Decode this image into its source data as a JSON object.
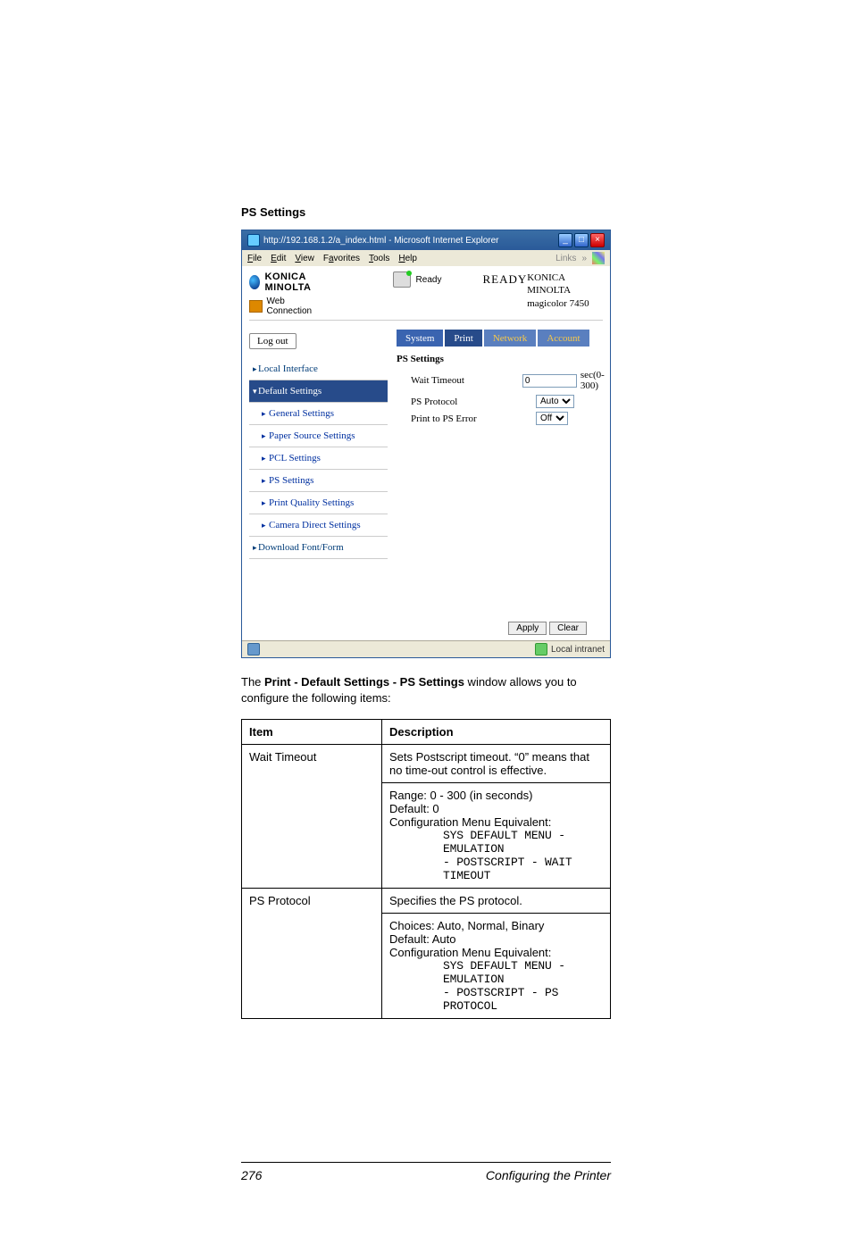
{
  "section_title": "PS Settings",
  "browser": {
    "title": "http://192.168.1.2/a_index.html - Microsoft Internet Explorer",
    "menus": [
      "File",
      "Edit",
      "View",
      "Favorites",
      "Tools",
      "Help"
    ],
    "links_label": "Links"
  },
  "header": {
    "brand": "KONICA MINOLTA",
    "pagescope": "Web Connection",
    "status_small": "Ready",
    "status_big": "READY",
    "product_line1": "KONICA MINOLTA",
    "product_line2": "magicolor 7450"
  },
  "logout_label": "Log out",
  "tabs": {
    "system": "System",
    "print": "Print",
    "network": "Network",
    "account": "Account"
  },
  "sidebar": {
    "local_interface": "Local Interface",
    "default_settings": "Default Settings",
    "general_settings": "General Settings",
    "paper_source_settings": "Paper Source Settings",
    "pcl_settings": "PCL Settings",
    "ps_settings": "PS Settings",
    "print_quality_settings": "Print Quality Settings",
    "camera_direct_settings": "Camera Direct Settings",
    "download_font_form": "Download Font/Form"
  },
  "panel": {
    "title": "PS Settings",
    "wait_timeout_label": "Wait Timeout",
    "wait_timeout_value": "0",
    "wait_timeout_hint": "sec(0-300)",
    "ps_protocol_label": "PS Protocol",
    "ps_protocol_value": "Auto",
    "print_ps_error_label": "Print to PS Error",
    "print_ps_error_value": "Off"
  },
  "buttons": {
    "apply": "Apply",
    "clear": "Clear"
  },
  "statusbar": {
    "done": "",
    "zone": "Local intranet"
  },
  "caption": {
    "pre": "The ",
    "bold": "Print - Default Settings - PS Settings",
    "post": " window allows you to configure the following items:"
  },
  "table": {
    "head_item": "Item",
    "head_desc": "Description",
    "row1": {
      "item": "Wait Timeout",
      "p1": "Sets Postscript timeout. “0” means that no time-out control is effective.",
      "range": "Range:  0 - 300 (in seconds)",
      "default": "Default:  0",
      "cfg": "Configuration Menu Equivalent:",
      "m1": "SYS DEFAULT MENU - EMULATION",
      "m2": "- POSTSCRIPT - WAIT TIMEOUT"
    },
    "row2": {
      "item": "PS Protocol",
      "p1": "Specifies the PS protocol.",
      "choices": "Choices: Auto, Normal, Binary",
      "default": "Default:  Auto",
      "cfg": "Configuration Menu Equivalent:",
      "m1": "SYS DEFAULT MENU - EMULATION",
      "m2": "- POSTSCRIPT - PS PROTOCOL"
    }
  },
  "footer": {
    "page": "276",
    "label": "Configuring the Printer"
  }
}
